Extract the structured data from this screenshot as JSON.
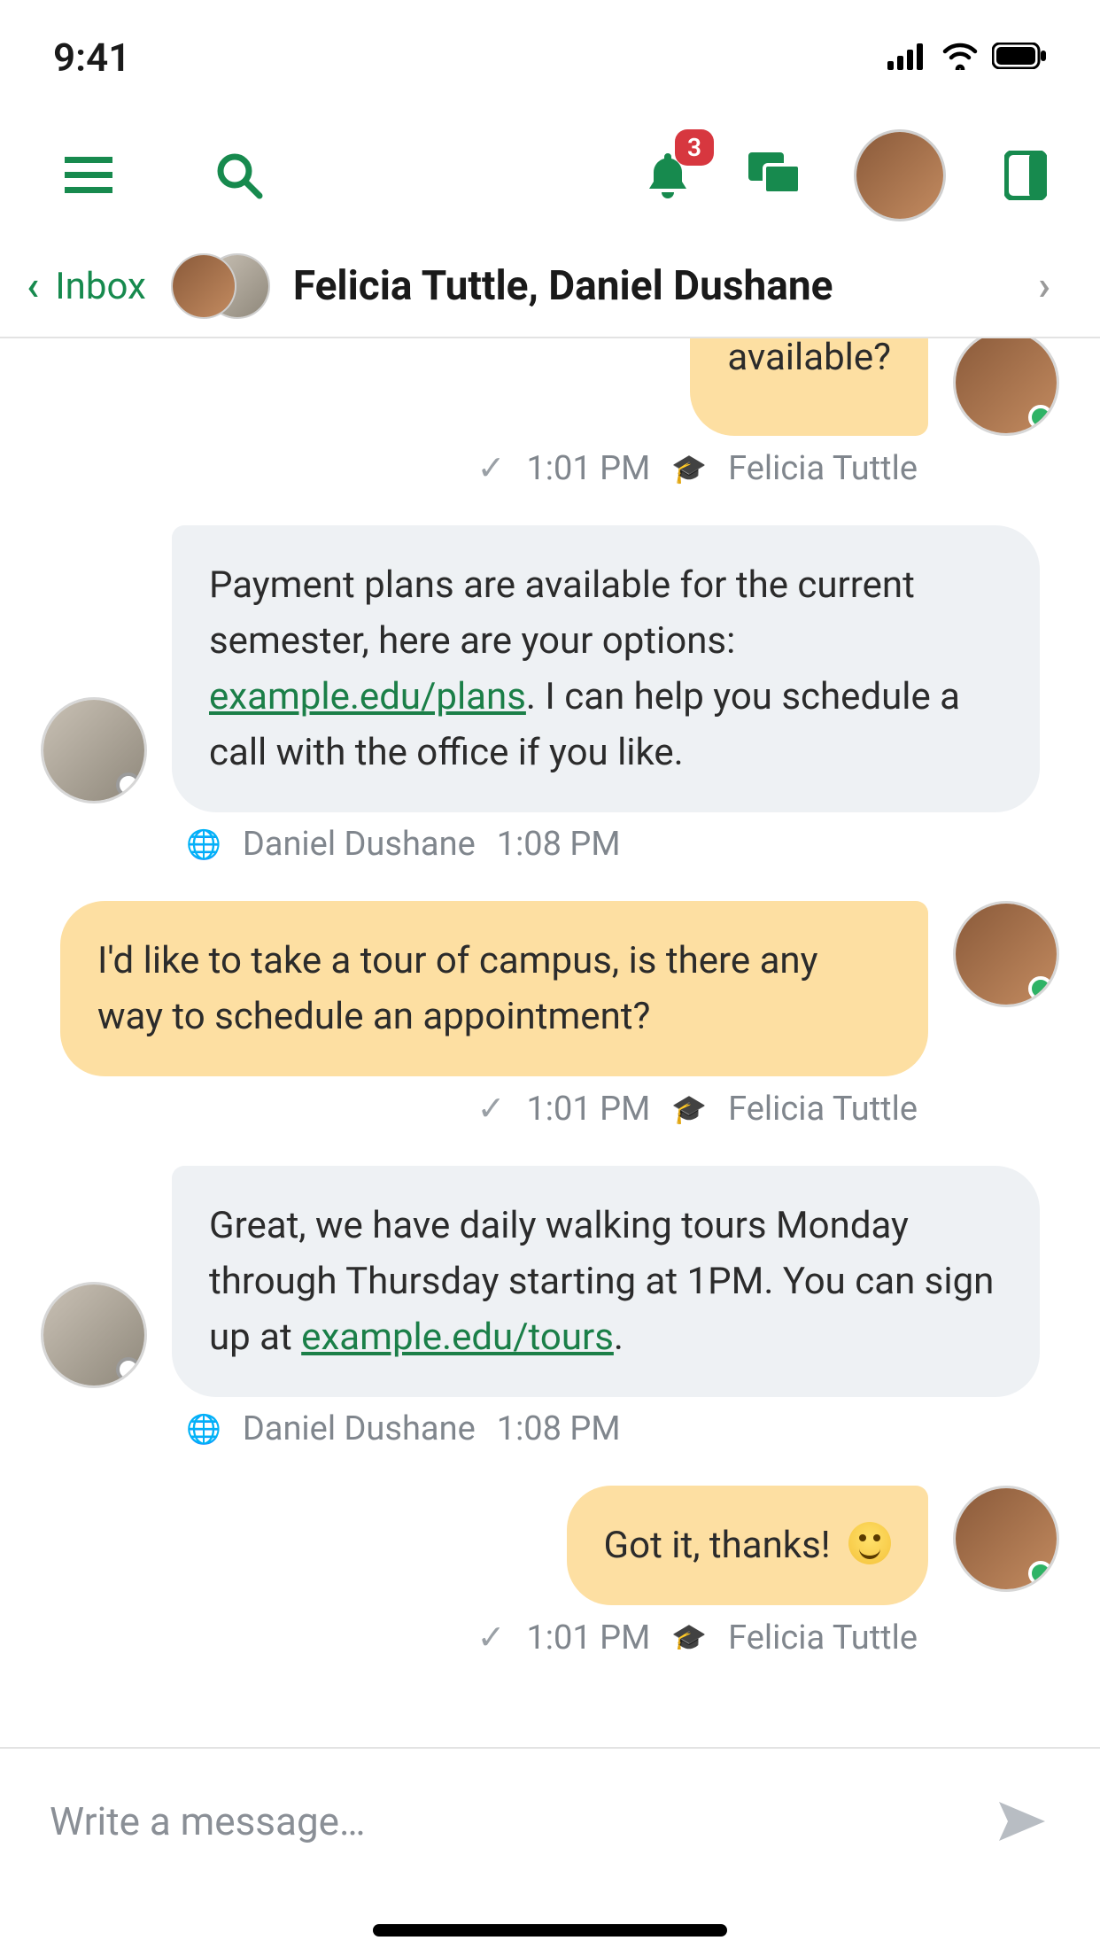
{
  "status": {
    "time": "9:41"
  },
  "nav": {
    "notification_count": "3"
  },
  "header": {
    "back_label": "Inbox",
    "title": "Felicia Tuttle, Daniel Dushane"
  },
  "messages": {
    "m0": {
      "text": "available?",
      "time": "1:01 PM",
      "sender": "Felicia Tuttle"
    },
    "m1": {
      "pre": "Payment plans are available for the current semester, here are your options: ",
      "link": "example.edu/plans",
      "post": ". I can help you schedule a call with the office if you like.",
      "sender": "Daniel Dushane",
      "time": "1:08 PM"
    },
    "m2": {
      "text": "I'd like to take a tour of campus, is there any way to schedule an appointment?",
      "time": "1:01 PM",
      "sender": "Felicia Tuttle"
    },
    "m3": {
      "pre": "Great, we have daily walking tours Monday through Thursday starting at 1PM. You can sign up at ",
      "link": "example.edu/tours",
      "post": ".",
      "sender": "Daniel Dushane",
      "time": "1:08 PM"
    },
    "m4": {
      "text": "Got it, thanks!",
      "time": "1:01 PM",
      "sender": "Felicia Tuttle"
    }
  },
  "compose": {
    "placeholder": "Write a message…"
  }
}
